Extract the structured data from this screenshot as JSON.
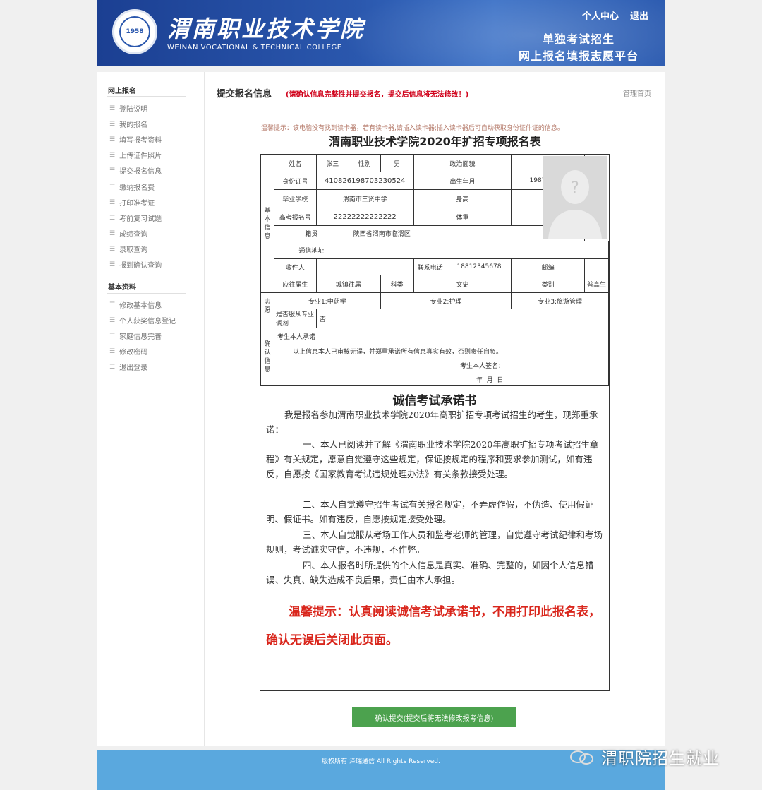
{
  "header": {
    "college_cn": "渭南职业技术学院",
    "college_en": "WEINAN VOCATIONAL & TECHNICAL COLLEGE",
    "links": [
      "个人中心",
      "退出"
    ],
    "platform_line1": "单独考试招生",
    "platform_line2": "网上报名填报志愿平台"
  },
  "sidebar": {
    "section1_title": "网上报名",
    "section1_items": [
      "登陆说明",
      "我的报名",
      "填写报考资料",
      "上传证件照片",
      "提交报名信息",
      "缴纳报名费",
      "打印准考证",
      "考前复习试题",
      "成绩查询",
      "录取查询",
      "报到确认查询"
    ],
    "section2_title": "基本资料",
    "section2_items": [
      "修改基本信息",
      "个人获奖信息登记",
      "家庭信息完善",
      "修改密码",
      "退出登录"
    ]
  },
  "main": {
    "title": "提交报名信息",
    "warning": "(请确认信息完整性并提交报名，提交后信息将无法修改！)",
    "home_link": "管理首页",
    "tip": "温馨提示：该电脑没有找到读卡器，若有读卡器,请插入读卡器;插入读卡器后可自动获取身份证件证的信息。",
    "form_title": "渭南职业技术学院2020年扩招专项报名表"
  },
  "form": {
    "section_basic": "基本信息",
    "section_wish": "志愿一",
    "section_confirm": "确认信息",
    "labels": {
      "name": "姓名",
      "gender": "性别",
      "political": "政治面貌",
      "id_no": "身份证号",
      "birth": "出生年月",
      "school": "毕业学校",
      "height": "身高",
      "exam_no": "高考报名号",
      "weight": "体重",
      "origin": "籍贯",
      "address": "通信地址",
      "receiver": "收件人",
      "phone": "联系电话",
      "postcode": "邮编",
      "grad_type": "应往届生",
      "category": "科类",
      "class_type": "类别"
    },
    "values": {
      "name": "张三",
      "gender": "男",
      "political": "",
      "id_no": "410826198703230524",
      "birth": "1987-03-23",
      "school": "渭南市三贤中学",
      "height": "",
      "exam_no": "22222222222222",
      "weight": "",
      "origin": "陕西省渭南市临渭区",
      "address": "",
      "receiver": "",
      "phone": "18812345678",
      "postcode": "",
      "grad_type": "城镇往届",
      "category": "文史",
      "class_type": "普高生"
    },
    "majors": [
      "专业1:中药学",
      "专业2:护理",
      "专业3:旅游管理"
    ],
    "adjust_label": "是否服从专业调剂",
    "adjust_value": "否",
    "confirm_title": "考生本人承诺",
    "confirm_text": "以上信息本人已审核无误，并郑重承诺所有信息真实有效，否则责任自负。",
    "signature": "考生本人签名：",
    "date_line": "年  月  日"
  },
  "oath": {
    "title": "诚信考试承诺书",
    "intro": "我是报名参加渭南职业技术学院2020年高职扩招专项考试招生的考生，现郑重承诺：",
    "p1": "一、本人已阅读并了解《渭南职业技术学院2020年高职扩招专项考试招生章程》有关规定，愿意自觉遵守这些规定，保证按规定的程序和要求参加测试，如有违反，自愿按《国家教育考试违规处理办法》有关条款接受处理。",
    "p2": "二、本人自觉遵守招生考试有关报名规定，不弄虚作假，不伪造、使用假证明、假证书。如有违反，自愿按规定接受处理。",
    "p3": "三、本人自觉服从考场工作人员和监考老师的管理，自觉遵守考试纪律和考场规则，考试诚实守信，不违规，不作弊。",
    "p4": "四、本人报名时所提供的个人信息是真实、准确、完整的，如因个人信息错误、失真、缺失造成不良后果，责任由本人承担。",
    "red_tip": "温馨提示：认真阅读诚信考试承诺书，不用打印此报名表，确认无误后关闭此页面。"
  },
  "submit_label": "确认提交(提交后将无法修改报考信息)",
  "footer": {
    "copyright": "版权所有 泽瑞通信 All Rights Reserved."
  },
  "watermark": "渭职院招生就业"
}
